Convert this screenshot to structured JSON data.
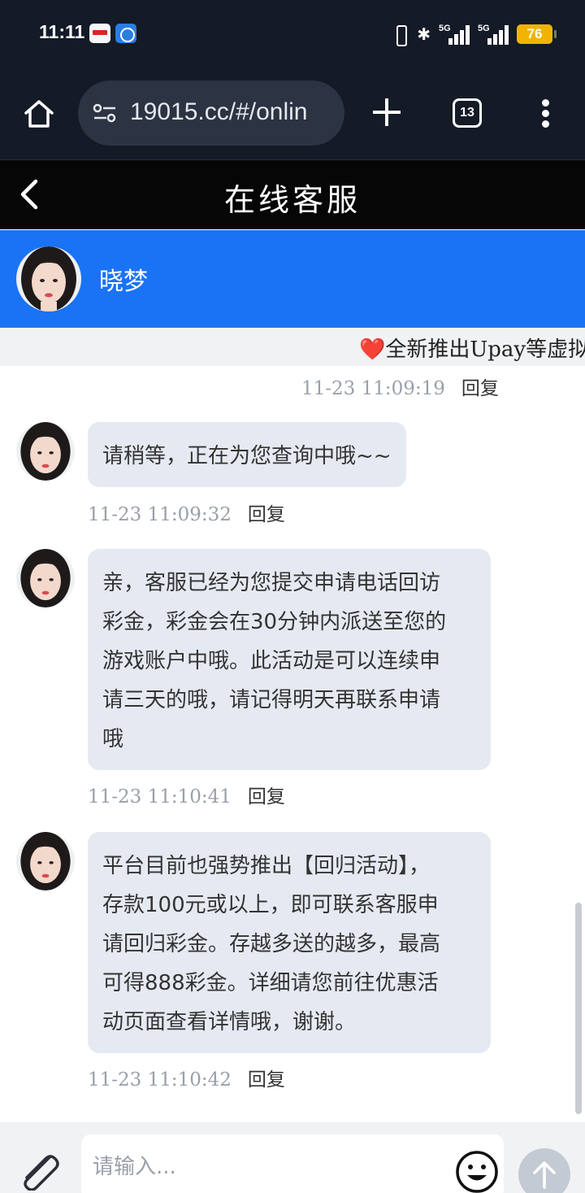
{
  "status_bar": {
    "time": "11:11",
    "signal_1_label": "5G",
    "signal_2_label": "5G",
    "battery": "76",
    "battery_color": "#f0b400"
  },
  "browser": {
    "url": "19015.cc/#/onlin",
    "tab_count": "13",
    "icons": [
      "home-icon",
      "site-settings-icon",
      "plus-icon",
      "tabs-icon",
      "more-vertical-icon"
    ]
  },
  "header": {
    "title": "在线客服",
    "back_icon": "chevron-left-icon"
  },
  "agent": {
    "name": "晓梦",
    "accent_color": "#1a73f5"
  },
  "notice": {
    "heart": "❤️",
    "text": "全新推出Upay等虚拟"
  },
  "messages": [
    {
      "timestamp": "11-23 11:09:19",
      "reply_label": "回复",
      "text": ""
    },
    {
      "timestamp": "11-23 11:09:32",
      "reply_label": "回复",
      "lines": [
        "请稍等，正在为您查询中哦~~"
      ]
    },
    {
      "timestamp": "11-23 11:10:41",
      "reply_label": "回复",
      "lines": [
        "亲，客服已经为您提交申请电话回访",
        "彩金，彩金会在30分钟内派送至您的",
        "游戏账户中哦。此活动是可以连续申",
        "请三天的哦，请记得明天再联系申请",
        "哦"
      ]
    },
    {
      "timestamp": "11-23 11:10:42",
      "reply_label": "回复",
      "lines": [
        "平台目前也强势推出【回归活动】，",
        "存款100元或以上，即可联系客服申",
        "请回归彩金。存越多送的越多，最高",
        "可得888彩金。详细请您前往优惠活",
        "动页面查看详情哦，谢谢。"
      ]
    }
  ],
  "input": {
    "placeholder": "请输入...",
    "value": "",
    "icons": [
      "paperclip-icon",
      "smiley-icon",
      "send-arrow-icon"
    ]
  }
}
